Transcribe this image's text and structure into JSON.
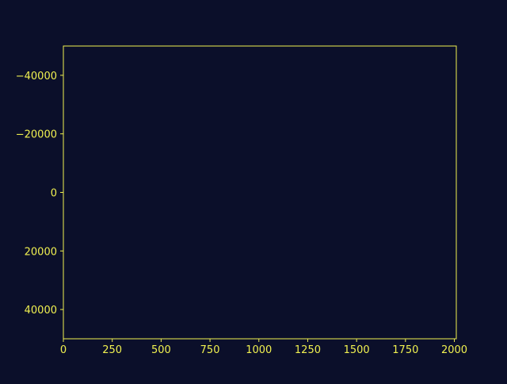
{
  "chart_data": {
    "type": "scatter",
    "title": "",
    "xlabel": "",
    "ylabel": "",
    "xlim": [
      0,
      2010
    ],
    "ylim": [
      50000,
      -50000
    ],
    "y_inverted": true,
    "x_ticks": [
      0,
      250,
      500,
      750,
      1000,
      1250,
      1500,
      1750,
      2000
    ],
    "x_tick_labels": [
      "0",
      "250",
      "500",
      "750",
      "1000",
      "1250",
      "1500",
      "1750",
      "2000"
    ],
    "y_ticks": [
      -40000,
      -20000,
      0,
      20000,
      40000
    ],
    "y_tick_labels": [
      "−40000",
      "−20000",
      "0",
      "20000",
      "40000"
    ],
    "grid": false,
    "series": []
  },
  "style": {
    "background": "#0b0f2a",
    "axis_color": "#f0f050",
    "text_color": "#f0f050"
  }
}
